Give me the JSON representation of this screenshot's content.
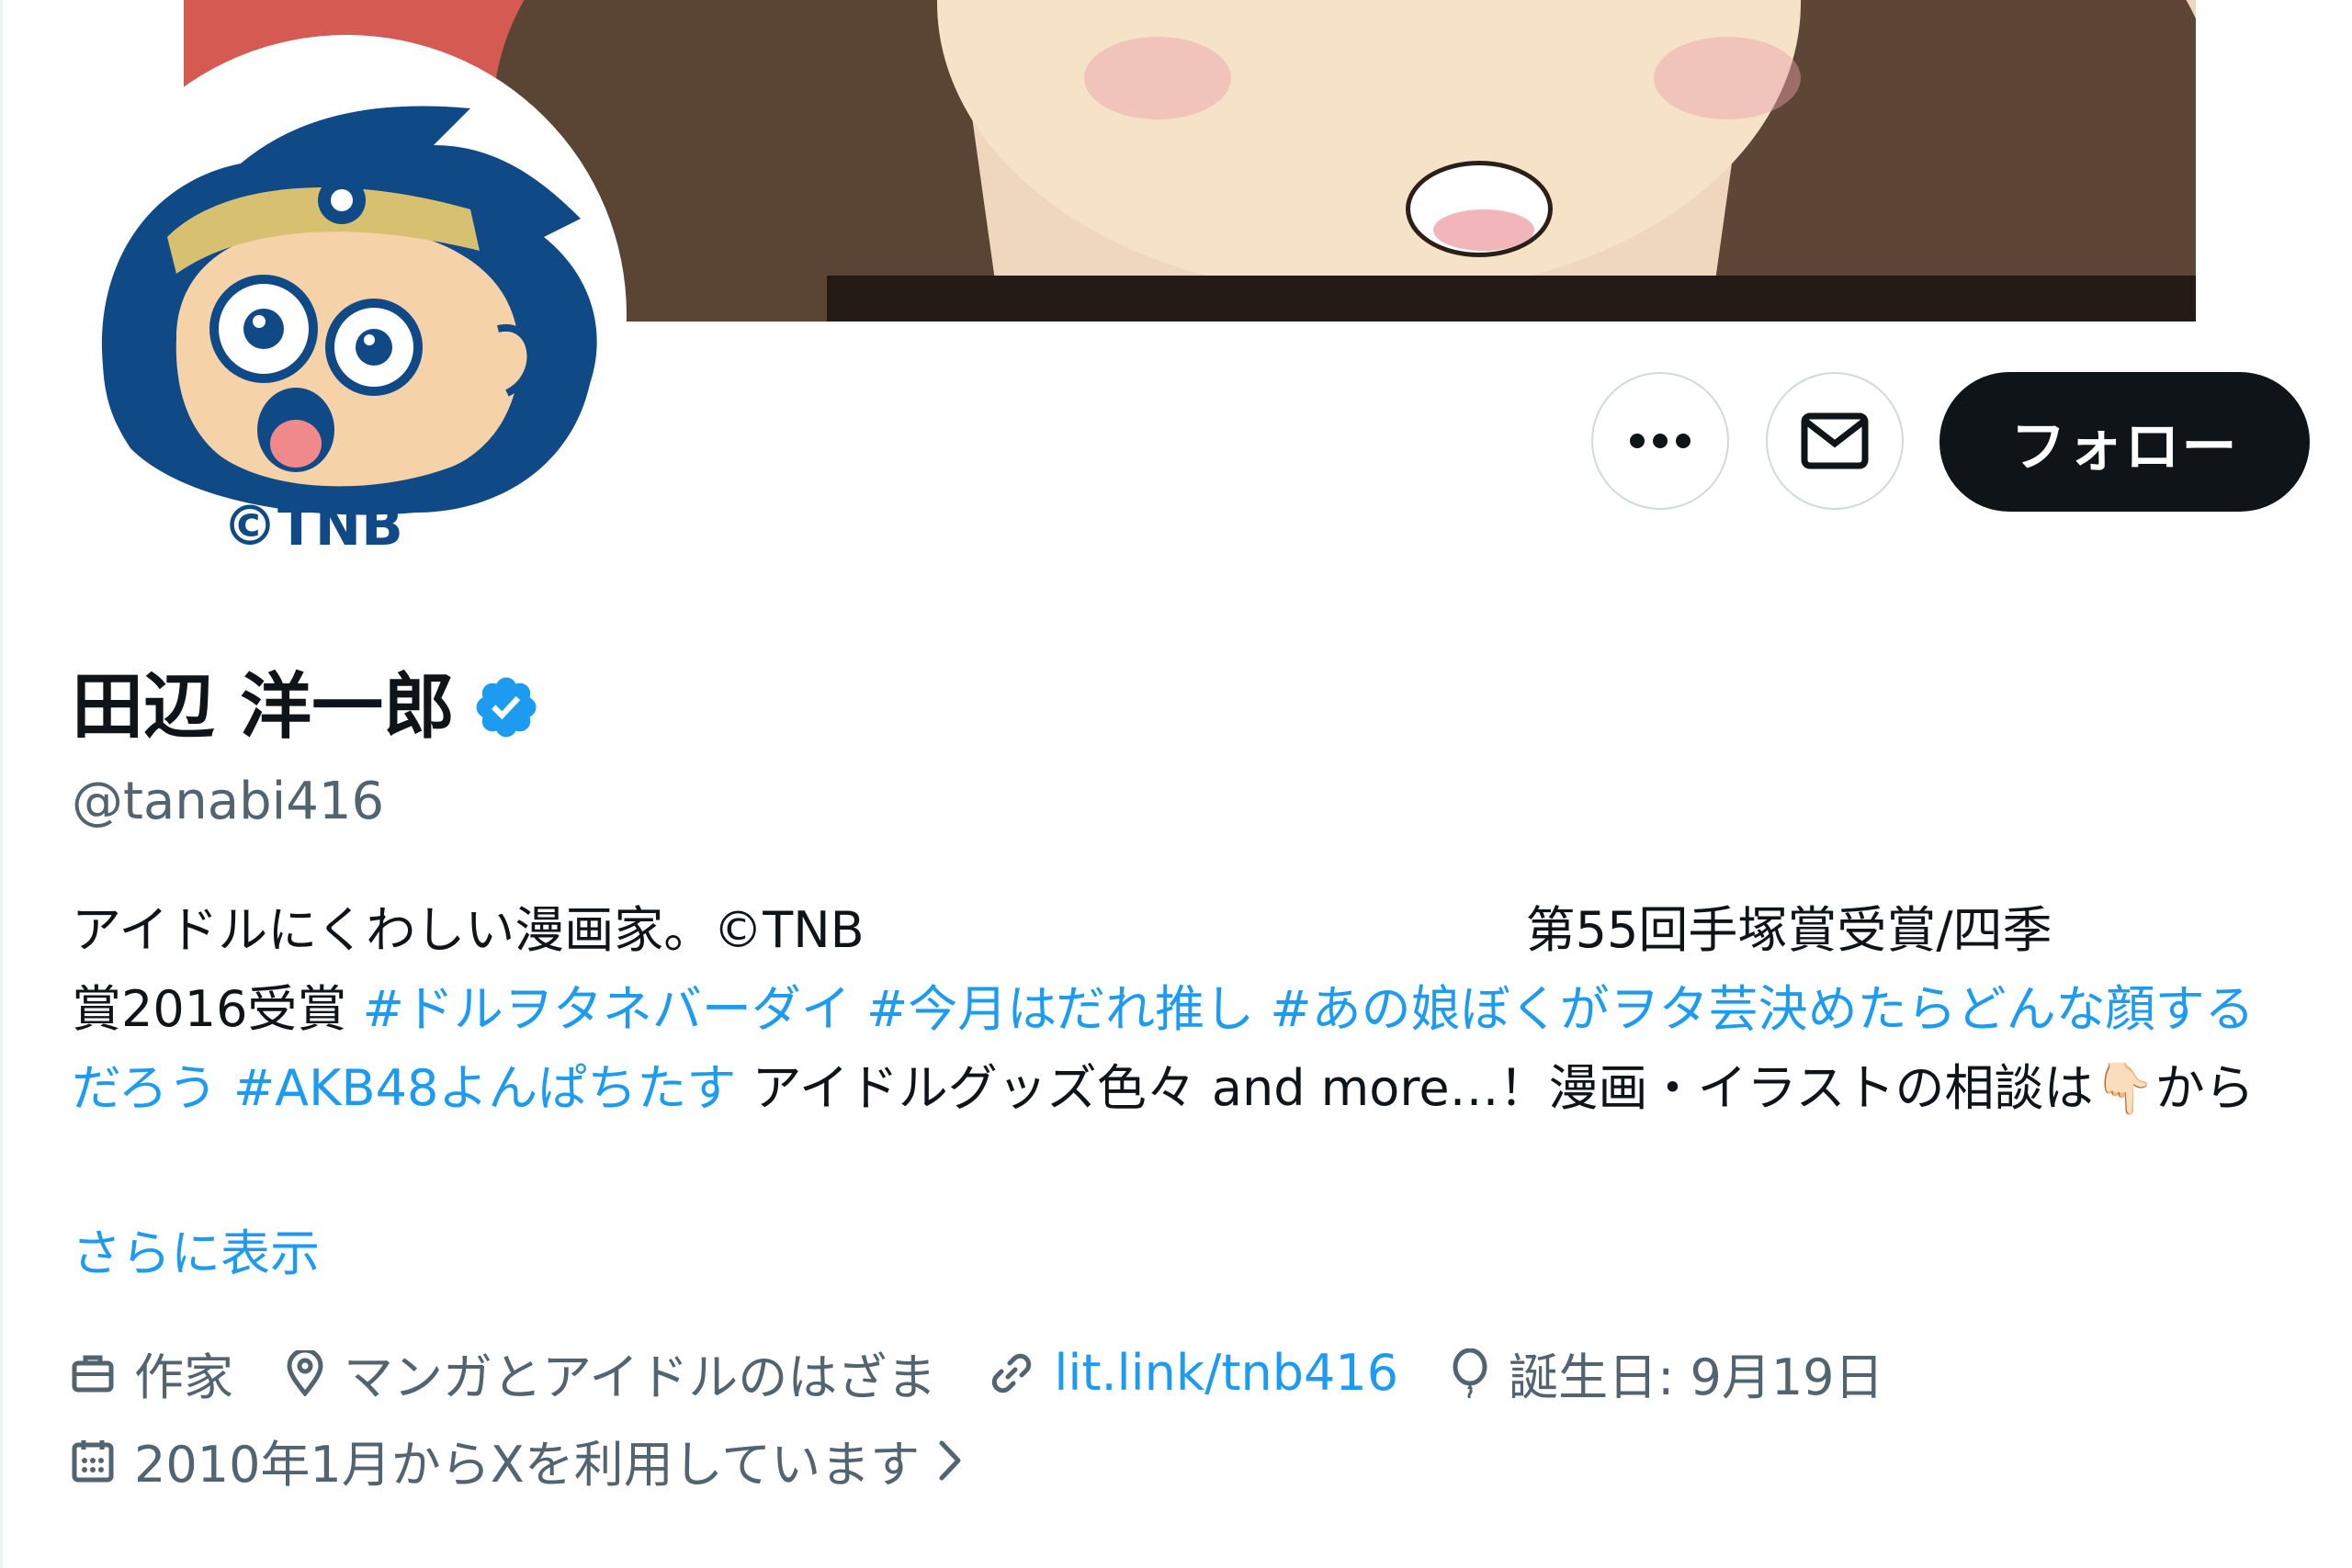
{
  "profile": {
    "display_name": "田辺 洋一郎",
    "handle": "@tanabi416",
    "avatar_caption": "©TNB"
  },
  "actions": {
    "more_label": "…",
    "message_label": "メッセージ",
    "follow_label": "フォロー"
  },
  "bio": {
    "line1_text": "アイドルにくわしい漫画家。©TNB",
    "line1_right": "第55回手塚賞受賞/四季",
    "line2_text": "賞2016受賞 ",
    "hashtags": [
      "#ドルヲタネバーダイ",
      "#今月はだれ推し",
      "#あの娘ぼくがヲタ芸決めたらどんな顔するだろう",
      "#AKB48よんぱちたす"
    ],
    "tail_text": " アイドルグッズ色々 and more…！漫画・イラストの相談は",
    "emoji": "👇🏻",
    "end_text": "から",
    "show_more": "さらに表示"
  },
  "meta": {
    "profession": "作家",
    "location": "マンガとアイドルのはざま",
    "link": "lit.link/tnb416",
    "birthday": "誕生日: 9月19日",
    "joined": "2010年1月からXを利用しています"
  },
  "colors": {
    "accent": "#1d9bf0",
    "text": "#0f1419",
    "secondary": "#536471",
    "follow_bg": "#0f1419",
    "border": "#cfd9de"
  },
  "icons": {
    "verified": "verified-badge-icon",
    "profession": "briefcase-icon",
    "location": "map-pin-icon",
    "link": "link-icon",
    "birthday": "balloon-icon",
    "joined": "calendar-icon",
    "more": "ellipsis-icon",
    "message": "envelope-icon",
    "chevron": "chevron-right-icon"
  }
}
